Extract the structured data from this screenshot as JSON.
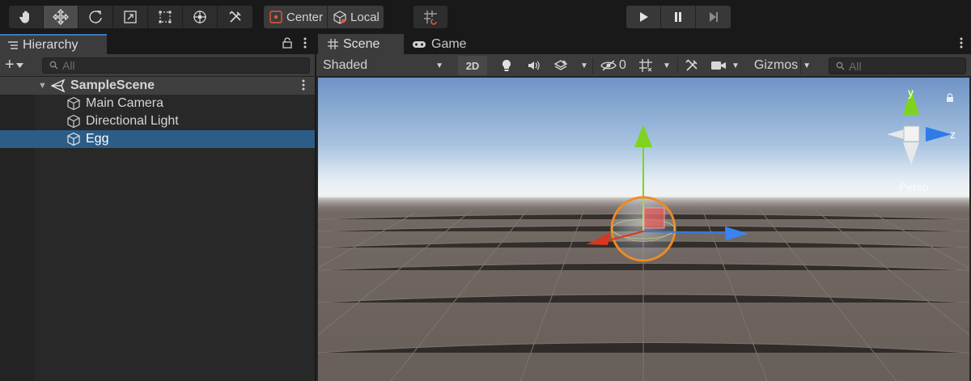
{
  "toolbar": {
    "transform_tools": [
      {
        "name": "hand-tool",
        "icon": "hand-icon",
        "active": false
      },
      {
        "name": "move-tool",
        "icon": "move-arrows-icon",
        "active": true
      },
      {
        "name": "rotate-tool",
        "icon": "rotate-icon",
        "active": false
      },
      {
        "name": "scale-tool",
        "icon": "scale-icon",
        "active": false
      },
      {
        "name": "rect-tool",
        "icon": "rect-transform-icon",
        "active": false
      },
      {
        "name": "transform-tool",
        "icon": "transform-icon",
        "active": false
      },
      {
        "name": "custom-tool",
        "icon": "tools-icon",
        "active": false
      }
    ],
    "pivot_label": "Center",
    "rotation_label": "Local",
    "snap_icon": "grid-snap-icon",
    "play_controls": [
      "play-icon",
      "pause-icon",
      "step-icon"
    ]
  },
  "hierarchy": {
    "tab_label": "Hierarchy",
    "search_placeholder": "All",
    "scene_name": "SampleScene",
    "items": [
      {
        "label": "Main Camera",
        "selected": false
      },
      {
        "label": "Directional Light",
        "selected": false
      },
      {
        "label": "Egg",
        "selected": true
      }
    ]
  },
  "scene_view": {
    "tabs": {
      "scene": "Scene",
      "game": "Game"
    },
    "draw_mode": "Shaded",
    "mode_2d": "2D",
    "hidden_count": "0",
    "gizmos_label": "Gizmos",
    "search_placeholder": "All",
    "projection_label": "Persp",
    "axis_labels": {
      "y": "y",
      "z": "z"
    }
  },
  "colors": {
    "accent": "#3a79bb",
    "selection": "#2c5d87",
    "x_axis": "#d5391f",
    "y_axis": "#7ed321",
    "z_axis": "#2f7be8",
    "outline": "#f08a24"
  }
}
